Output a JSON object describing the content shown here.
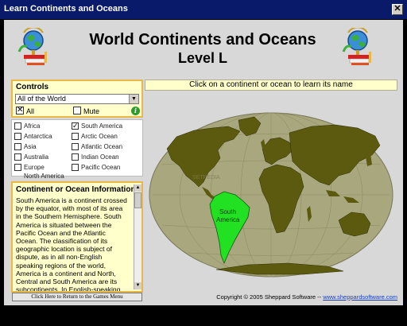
{
  "window": {
    "title": "Learn Continents and Oceans",
    "close_label": "✕"
  },
  "header": {
    "title": "World Continents and Oceans",
    "level": "Level L"
  },
  "prompt": "Click on a continent or ocean to learn its name",
  "controls": {
    "heading": "Controls",
    "region_select": "All of the World",
    "all_label": "All",
    "all_checked": true,
    "mute_label": "Mute",
    "mute_checked": false,
    "info_label": "i"
  },
  "checklist": [
    {
      "label": "Africa",
      "checked": false
    },
    {
      "label": "South America",
      "checked": true
    },
    {
      "label": "Antarctica",
      "checked": false
    },
    {
      "label": "Arctic Ocean",
      "checked": false
    },
    {
      "label": "Asia",
      "checked": false
    },
    {
      "label": "Atlantic Ocean",
      "checked": false
    },
    {
      "label": "Australia",
      "checked": false
    },
    {
      "label": "Indian Ocean",
      "checked": false
    },
    {
      "label": "Europe",
      "checked": false
    },
    {
      "label": "Pacific Ocean",
      "checked": false
    },
    {
      "label": "North America",
      "checked": false
    }
  ],
  "info": {
    "heading": "Continent or Ocean Information",
    "text": "South America is a continent crossed by the equator, with most of its area in the Southern Hemisphere. South America is situated between the Pacific Ocean and the Atlantic Ocean. The classification of its geographic location is subject of dispute, as in all non-English speaking regions of the world, America is a continent and North, Central and South America are its subcontinents. In English-speaking and certain other"
  },
  "return_button": "Click Here to Return to the Games Menu",
  "map": {
    "highlight_label_1": "South",
    "highlight_label_2": "America",
    "watermark": "SETPEDIA"
  },
  "copyright": {
    "text": "Copyright © 2005 Sheppard Software -- ",
    "link": "www.sheppardsoftware.com"
  },
  "colors": {
    "land": "#5b5a0e",
    "highlight": "#22e022",
    "ocean": "#a9a77e",
    "panel_border": "#e8b84a",
    "title_bar": "#0a1a6b"
  }
}
